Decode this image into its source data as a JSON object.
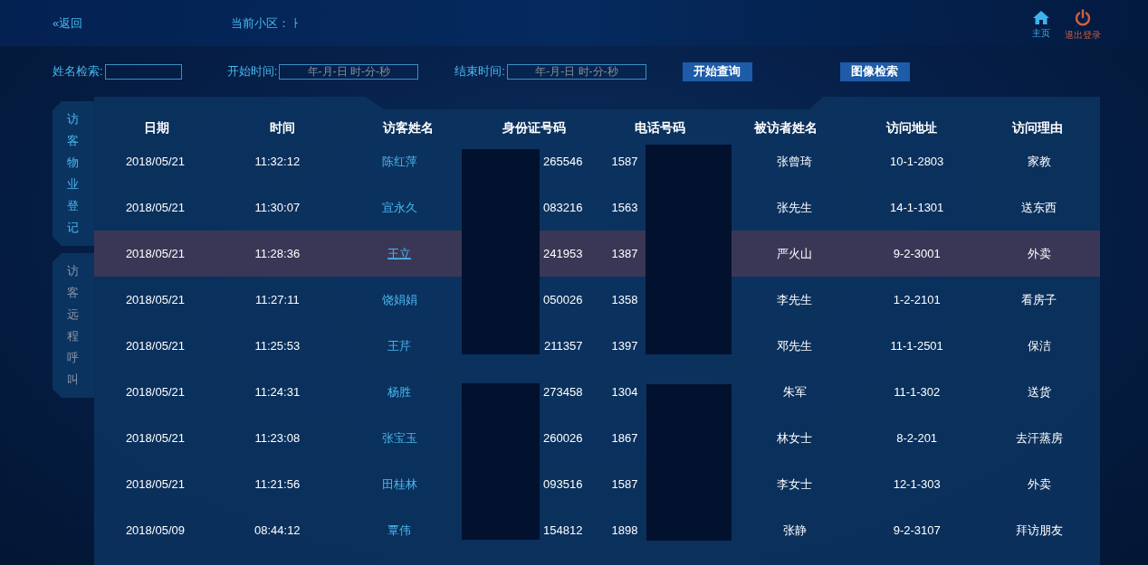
{
  "header": {
    "back": "«返回",
    "community_label": "当前小区：",
    "community_value": "ㅏ",
    "home": "主页",
    "logout": "退出登录"
  },
  "filters": [
    {
      "label": "姓名检索:"
    },
    {
      "label": "开始时间:",
      "placeholder": "年-月-日 时-分-秒"
    },
    {
      "label": "结束时间:",
      "placeholder": "年-月-日 时-分-秒"
    }
  ],
  "buttons": [
    "开始查询",
    "图像检索"
  ],
  "side_tabs": [
    {
      "label": "访客物业登记",
      "selected": true
    },
    {
      "label": "访客远程呼叫",
      "selected": false
    }
  ],
  "table": {
    "columns": [
      "日期",
      "时间",
      "访客姓名",
      "身份证号码",
      "电话号码",
      "被访者姓名",
      "访问地址",
      "访问理由"
    ],
    "rows": [
      {
        "selected": false,
        "cells": [
          "2018/05/21",
          "11:32:12",
          "陈红萍",
          "265546",
          "1587",
          "张曾琦",
          "10-1-2803",
          "家教"
        ]
      },
      {
        "selected": false,
        "cells": [
          "2018/05/21",
          "11:30:07",
          "宣永久",
          "083216",
          "1563",
          "张先生",
          "14-1-1301",
          "送东西"
        ]
      },
      {
        "selected": true,
        "cells": [
          "2018/05/21",
          "11:28:36",
          "王立",
          "241953",
          "1387",
          "严火山",
          "9-2-3001",
          "外卖"
        ]
      },
      {
        "selected": false,
        "cells": [
          "2018/05/21",
          "11:27:11",
          "饶娟娟",
          "050026",
          "1358",
          "李先生",
          "1-2-2101",
          "看房子"
        ]
      },
      {
        "selected": false,
        "cells": [
          "2018/05/21",
          "11:25:53",
          "王芹",
          "211357",
          "1397",
          "邓先生",
          "11-1-2501",
          "保洁"
        ]
      },
      {
        "selected": false,
        "cells": [
          "2018/05/21",
          "11:24:31",
          "杨胜",
          "273458",
          "1304",
          "朱军",
          "11-1-302",
          "送货"
        ]
      },
      {
        "selected": false,
        "cells": [
          "2018/05/21",
          "11:23:08",
          "张宝玉",
          "260026",
          "1867",
          "林女士",
          "8-2-201",
          "去汗蒸房"
        ]
      },
      {
        "selected": false,
        "cells": [
          "2018/05/21",
          "11:21:56",
          "田桂林",
          "093516",
          "1587",
          "李女士",
          "12-1-303",
          "外卖"
        ]
      },
      {
        "selected": false,
        "cells": [
          "2018/05/09",
          "08:44:12",
          "覃伟",
          "154812",
          "1898",
          "张静",
          "9-2-3107",
          "拜访朋友"
        ]
      }
    ]
  }
}
